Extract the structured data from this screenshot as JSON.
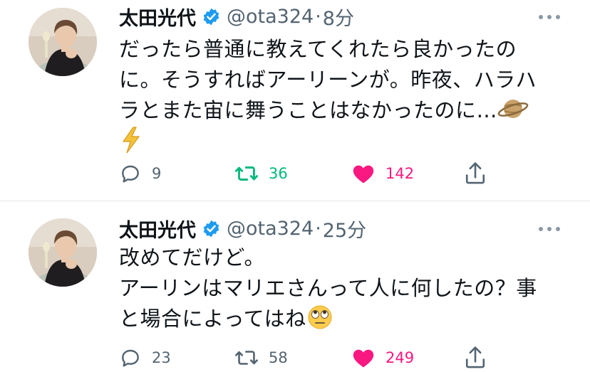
{
  "colors": {
    "verified": "#1d9bf0",
    "retweet_active": "#00ba7c",
    "like_active": "#f91880",
    "muted": "#536471",
    "divider": "#e3e7ea"
  },
  "tweets": [
    {
      "name": "太田光代",
      "handle": "@ota324",
      "separator": "·",
      "time": "8分",
      "lines": [
        "だったら普通に教えてくれたら良かったの",
        "に。そうすればアーリーンが。昨夜、ハラハ",
        "ラとまた宙に舞うことはなかったのに…"
      ],
      "emoji": [
        "ringed-planet-emoji",
        "lightning-emoji"
      ],
      "replies": "9",
      "retweets": "36",
      "likes": "142",
      "retweeted": true,
      "liked": true
    },
    {
      "name": "太田光代",
      "handle": "@ota324",
      "separator": "·",
      "time": "25分",
      "lines": [
        "改めてだけど。",
        "アーリンはマリエさんって人に何したの？事",
        "と場合によってはね"
      ],
      "emoji": [
        "face-with-rolling-eyes-emoji"
      ],
      "replies": "23",
      "retweets": "58",
      "likes": "249",
      "retweeted": false,
      "liked": true
    }
  ]
}
